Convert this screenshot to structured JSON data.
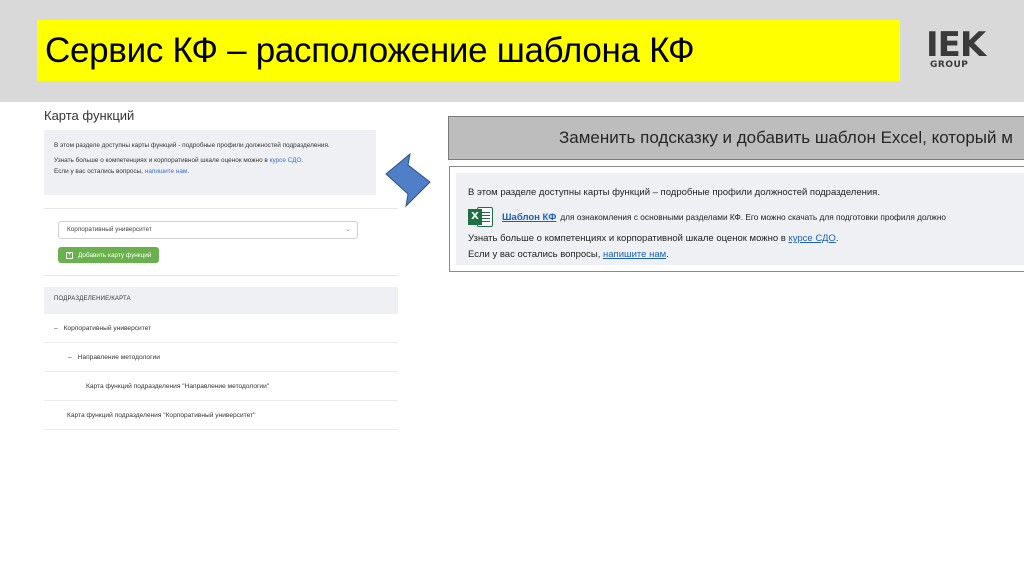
{
  "slide": {
    "title": "Сервис КФ – расположение шаблона КФ",
    "logo": {
      "main": "IEK",
      "sub": "GROUP"
    }
  },
  "left_screen": {
    "page_title": "Карта функций",
    "info": {
      "line1": "В этом разделе доступны карты функций - подробные профили должностей подразделения.",
      "line2_prefix": "Узнать больше о компетенциях и корпоративной шкале оценок можно в ",
      "line2_link": "курсе СДО",
      "line2_suffix": ".",
      "line3_prefix": "Если у вас остались вопросы, ",
      "line3_link": "напишите нам",
      "line3_suffix": "."
    },
    "select_value": "Корпоративный университет",
    "add_button_label": "Добавить карту функций",
    "table_header": "ПОДРАЗДЕЛЕНИЕ/КАРТА",
    "tree": [
      {
        "label": "Корпоративный университет",
        "toggle": "–"
      },
      {
        "label": "Направление методологии",
        "toggle": "–"
      },
      {
        "label": "Карта функций подразделения \"Направление методологии\"",
        "toggle": ""
      },
      {
        "label": "Карта функций подразделения \"Корпоративный университет\"",
        "toggle": ""
      }
    ]
  },
  "right_panel": {
    "gray_text": "Заменить подсказку и добавить шаблон Excel, который м",
    "line1": "В этом разделе доступны карты функций – подробные профили должностей подразделения.",
    "excel_icon_letter": "X",
    "excel_link": "Шаблон КФ",
    "excel_text": "для ознакомления с основными разделами КФ. Его можно скачать для подготовки профиля должно",
    "line3_prefix": "Узнать больше о компетенциях и корпоративной шкале оценок можно в ",
    "line3_link": "курсе СДО",
    "line3_suffix": ".",
    "line4_prefix": "Если у вас остались вопросы, ",
    "line4_link": "напишите нам",
    "line4_suffix": "."
  },
  "colors": {
    "title_bg": "#ffff00",
    "header_band": "#d9d9d9",
    "add_button": "#6ab04c",
    "arrow": "#4f7fc6",
    "excel_green": "#1d7044"
  }
}
